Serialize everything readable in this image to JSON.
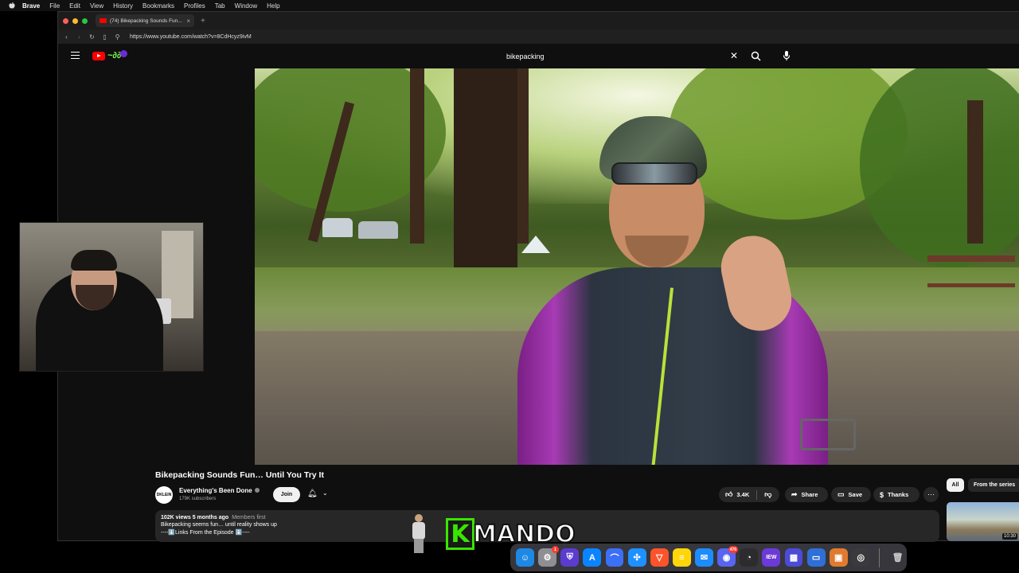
{
  "menubar": {
    "app": "Brave",
    "items": [
      "File",
      "Edit",
      "View",
      "History",
      "Bookmarks",
      "Profiles",
      "Tab",
      "Window",
      "Help"
    ]
  },
  "browser": {
    "tab_title": "(74) Bikepacking Sounds Fun...",
    "url": "https://www.youtube.com/watch?v=8CdHcyz9ivM"
  },
  "youtube": {
    "search_query": "bikepacking",
    "video": {
      "title": "Bikepacking Sounds Fun… Until You Try It",
      "channel": "Everything's Been Done",
      "avatar_text": "DKLEIN",
      "subscribers": "179K subscribers",
      "join_label": "Join",
      "likes": "3.4K",
      "share_label": "Share",
      "save_label": "Save",
      "thanks_label": "Thanks",
      "views_date": "102K views  5 months ago",
      "members_first": "Members first",
      "description_line1": "Bikepacking seems fun… until reality shows up",
      "description_line2": "----⬇️Links From the Episode ⬇️----"
    },
    "sidebar": {
      "chip_all": "All",
      "chip_series": "From the series",
      "thumb_duration": "10:30"
    }
  },
  "overlay": {
    "kmando_k": "K",
    "kmando_rest": "MANDO"
  },
  "dock": {
    "icons": [
      {
        "name": "finder-icon",
        "color": "#1e88e5",
        "glyph": "☺"
      },
      {
        "name": "system-settings-icon",
        "color": "#8e8e93",
        "glyph": "⚙",
        "badge": "1"
      },
      {
        "name": "bitwarden-icon",
        "color": "#5b3ccf",
        "glyph": "⛨"
      },
      {
        "name": "app-store-icon",
        "color": "#0a84ff",
        "glyph": "A"
      },
      {
        "name": "arc-icon",
        "color": "#3b6ff5",
        "glyph": "⌒"
      },
      {
        "name": "safari-icon",
        "color": "#1e90ff",
        "glyph": "✣"
      },
      {
        "name": "brave-icon",
        "color": "#fb542b",
        "glyph": "▽"
      },
      {
        "name": "notes-icon",
        "color": "#ffd60a",
        "glyph": "≡"
      },
      {
        "name": "mail-icon",
        "color": "#1c8cff",
        "glyph": "✉"
      },
      {
        "name": "discord-icon",
        "color": "#5865f2",
        "glyph": "◉",
        "badge": "476"
      },
      {
        "name": "activity-icon",
        "color": "#2c2c2e",
        "glyph": "◔"
      },
      {
        "name": "iew-icon",
        "color": "#6c3ad6",
        "glyph": "IEW"
      },
      {
        "name": "launchpad-icon",
        "color": "#4b4bd6",
        "glyph": "▦"
      },
      {
        "name": "screen-sharing-icon",
        "color": "#2f6fd6",
        "glyph": "▭"
      },
      {
        "name": "preview-icon",
        "color": "#e07a2e",
        "glyph": "▣"
      },
      {
        "name": "obs-icon",
        "color": "#3a3a3c",
        "glyph": "◎"
      }
    ],
    "trash_glyph": "🗑"
  }
}
